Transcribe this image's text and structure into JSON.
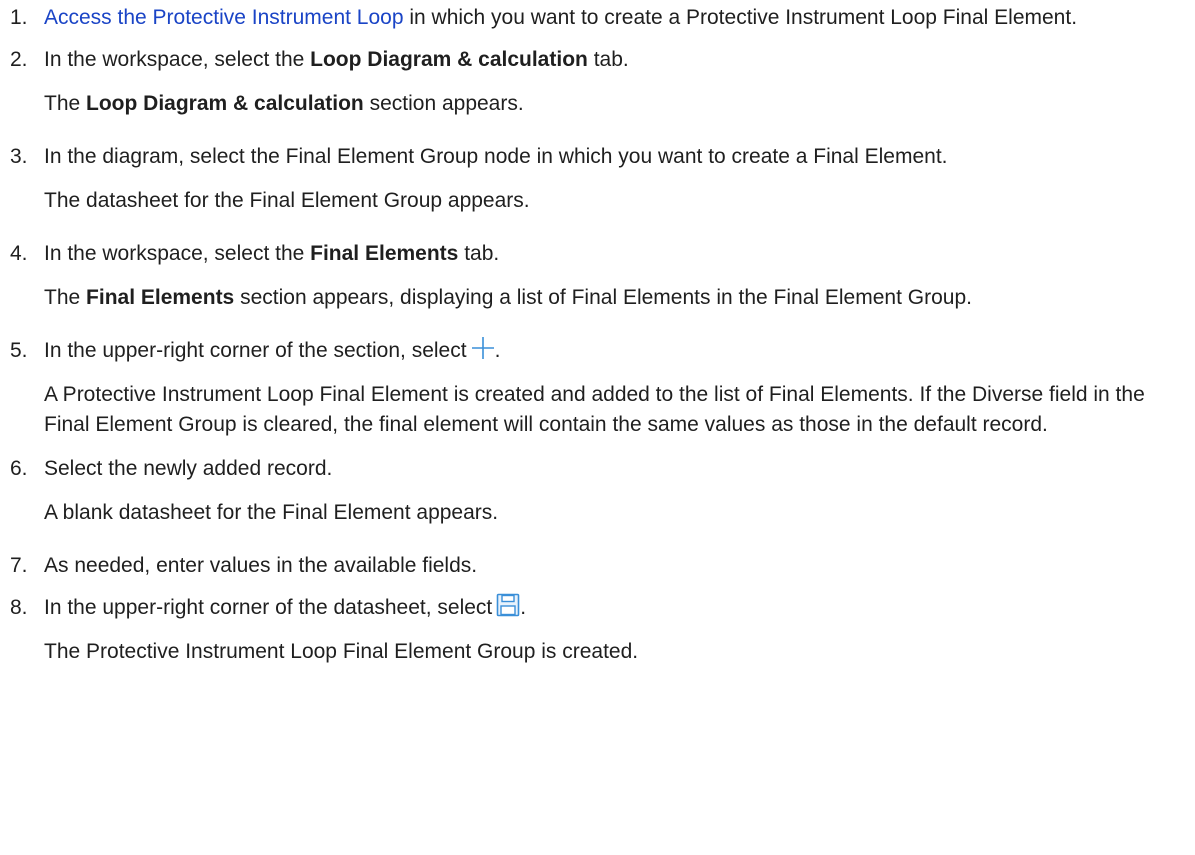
{
  "steps": [
    {
      "number": "1.",
      "link": "Access the Protective Instrument Loop",
      "text": " in which you want to create a Protective Instrument Loop Final Element."
    },
    {
      "number": "2.",
      "pre": "In the workspace, select the ",
      "bold": "Loop Diagram & calculation",
      "post": " tab.",
      "result_bold": "Loop Diagram & calculation",
      "result_post": " section appears.",
      "result_pre": "The "
    },
    {
      "number": "3.",
      "text": "In the diagram, select the Final Element Group node in which you want to create a Final Element.",
      "result": "The datasheet for the Final Element Group appears."
    },
    {
      "number": "4.",
      "pre": "In the workspace, select the ",
      "bold": "Final Elements",
      "post": " tab.",
      "result_pre": "The ",
      "result_bold": "Final Elements",
      "result_post": " section appears, displaying a list of Final Elements in the Final Element Group."
    },
    {
      "number": "5.",
      "pre": "In the upper-right corner of the section, select",
      "post": ".",
      "icon": "plus-icon",
      "result": "A Protective Instrument Loop Final Element is created and added to the list of Final Elements. If the Diverse field in the Final Element Group is cleared, the final element will contain the same values as those in the default record."
    },
    {
      "number": "6.",
      "text": "Select the newly added record.",
      "result": "A blank datasheet for the Final Element appears."
    },
    {
      "number": "7.",
      "text": "As needed, enter values in the available fields."
    },
    {
      "number": "8.",
      "pre": "In the upper-right corner of the datasheet, select",
      "post": ".",
      "icon": "save-icon",
      "result": "The Protective Instrument Loop Final Element Group is created."
    }
  ],
  "colors": {
    "text": "#1f1f1f",
    "link": "#1a44c6",
    "icon_blue": "#3a8fd8"
  }
}
